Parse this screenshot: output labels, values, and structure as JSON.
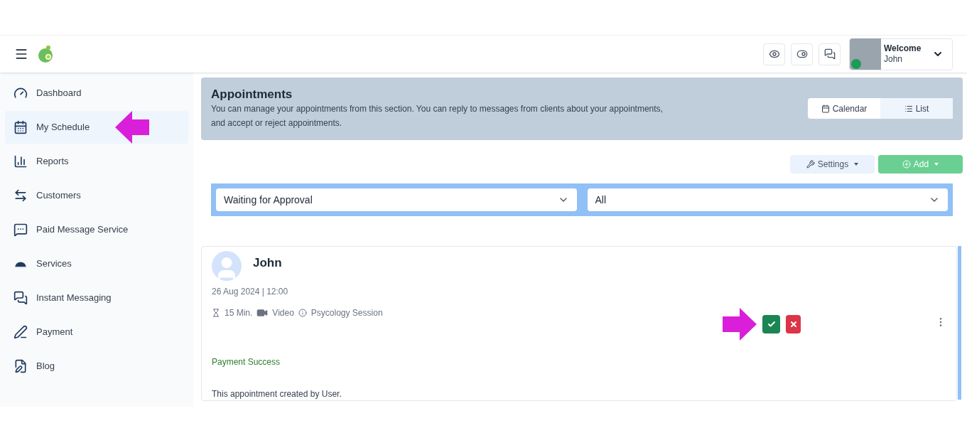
{
  "header": {
    "welcome": "Welcome",
    "user": "John",
    "online": true
  },
  "sidebar": {
    "items": [
      {
        "label": "Dashboard",
        "selected": false
      },
      {
        "label": "My Schedule",
        "selected": true
      },
      {
        "label": "Reports",
        "selected": false
      },
      {
        "label": "Customers",
        "selected": false
      },
      {
        "label": "Paid Message Service",
        "selected": false
      },
      {
        "label": "Services",
        "selected": false
      },
      {
        "label": "Instant Messaging",
        "selected": false
      },
      {
        "label": "Payment",
        "selected": false
      },
      {
        "label": "Blog",
        "selected": false
      }
    ]
  },
  "banner": {
    "title": "Appointments",
    "description": "You can manage your appointments from this section. You can reply to messages from clients about your appointments, and accept or reject appointments.",
    "views": [
      {
        "label": "Calendar",
        "selected": false
      },
      {
        "label": "List",
        "selected": true
      }
    ]
  },
  "toolbar": {
    "settings": "Settings",
    "add": "Add"
  },
  "filters": [
    {
      "value": "Waiting for Approval"
    },
    {
      "value": "All"
    }
  ],
  "appointment": {
    "name": "John",
    "datetime": "26 Aug 2024 | 12:00",
    "duration": "15 Min.",
    "type": "Video",
    "service": "Psycology Session",
    "payment_status": "Payment Success",
    "note": "This appointment created by User."
  }
}
